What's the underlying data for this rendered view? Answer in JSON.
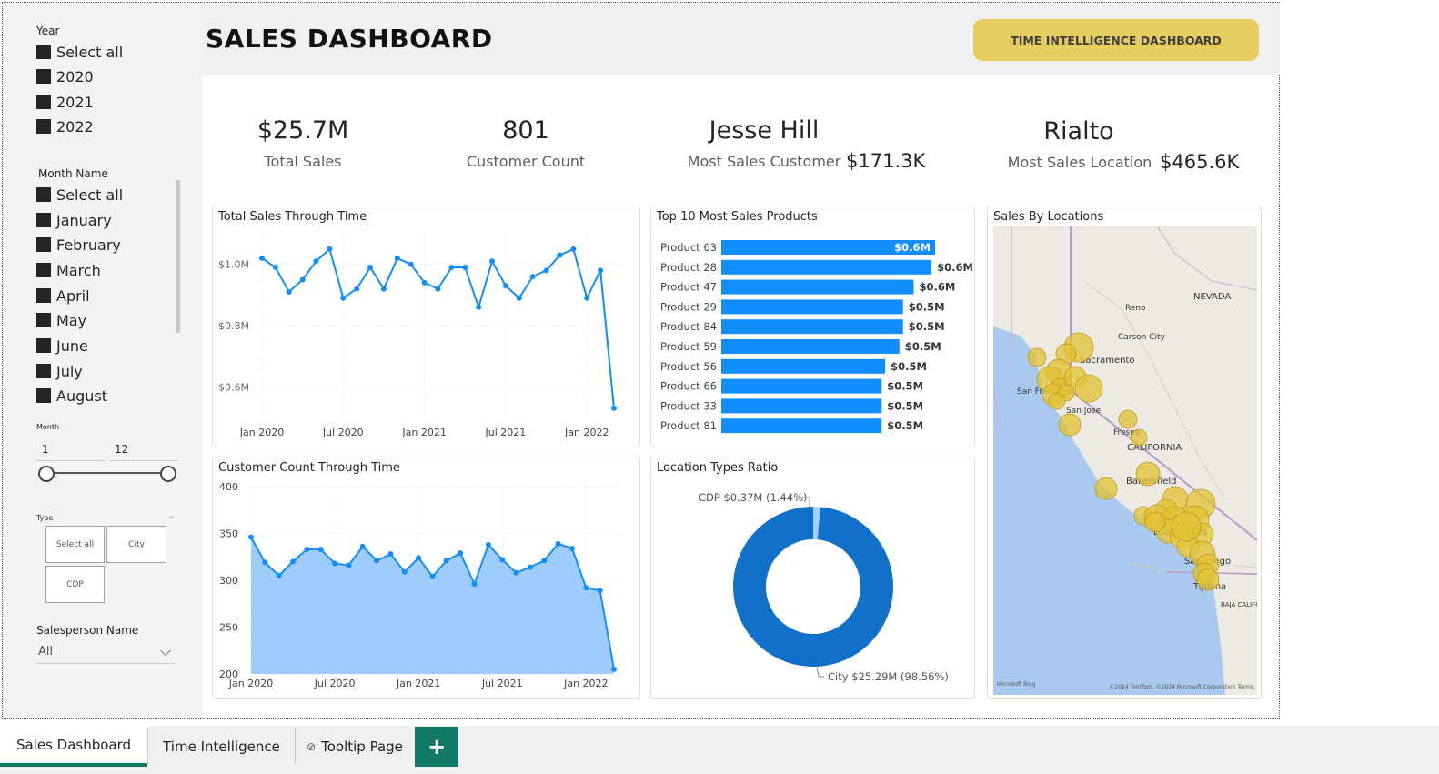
{
  "header": {
    "title": "SALES DASHBOARD",
    "ti_button": "TIME INTELLIGENCE DASHBOARD"
  },
  "slicers": {
    "year": {
      "title": "Year",
      "items": [
        "Select all",
        "2020",
        "2021",
        "2022"
      ]
    },
    "month_name": {
      "title": "Month Name",
      "items": [
        "Select all",
        "January",
        "February",
        "March",
        "April",
        "May",
        "June",
        "July",
        "August"
      ]
    },
    "month_range": {
      "title": "Month",
      "min": "1",
      "max": "12"
    },
    "type": {
      "title": "Type",
      "tiles": [
        "Select all",
        "City",
        "CDP"
      ]
    },
    "salesperson": {
      "title": "Salesperson Name",
      "value": "All"
    }
  },
  "kpis": {
    "total_sales": {
      "value": "$25.7M",
      "label": "Total Sales"
    },
    "customer_count": {
      "value": "801",
      "label": "Customer Count"
    },
    "top_customer": {
      "value": "Jesse Hill",
      "label": "Most Sales Customer",
      "amount": "$171.3K"
    },
    "top_location": {
      "value": "Rialto",
      "label": "Most Sales Location",
      "amount": "$465.6K"
    }
  },
  "visual_titles": {
    "sales_time": "Total Sales Through Time",
    "top_products": "Top 10 Most Sales Products",
    "locations": "Sales By Locations",
    "customer_time": "Customer Count Through Time",
    "location_types": "Location Types Ratio"
  },
  "map": {
    "labels": [
      "Reno",
      "NEVADA",
      "Carson City",
      "Sacramento",
      "San Francisco",
      "San Jose",
      "Fresno",
      "CALIFORNIA",
      "Bakersfield",
      "Los Angeles",
      "San Diego",
      "Tijuana",
      "BAJA CALIFORNIA"
    ],
    "attribution_left": "Microsoft Bing",
    "attribution_right": "©2024 TomTom, ©2024 Microsoft Corporation  Terms"
  },
  "tabs": [
    "Sales Dashboard",
    "Time Intelligence",
    "Tooltip Page"
  ],
  "tab_add_label": "+",
  "colors": {
    "accent": "#118dff",
    "area_fill": "#9fcdfb",
    "donut": "#1170c8",
    "donut_minor": "#a7cdf5",
    "bubble": "#e3c232",
    "button": "#e6cd62",
    "tab_active": "#117865"
  },
  "chart_data": [
    {
      "type": "line",
      "title": "Total Sales Through Time",
      "x_ticks": [
        "Jan 2020",
        "Jul 2020",
        "Jan 2021",
        "Jul 2021",
        "Jan 2022"
      ],
      "y_ticks": [
        "$1.0M",
        "$0.8M",
        "$0.6M"
      ],
      "ylim": [
        0.5,
        1.1
      ],
      "series": [
        {
          "values": [
            1.02,
            0.99,
            0.91,
            0.95,
            1.01,
            1.05,
            0.89,
            0.92,
            0.99,
            0.92,
            1.02,
            1.0,
            0.94,
            0.92,
            0.99,
            0.99,
            0.86,
            1.01,
            0.93,
            0.89,
            0.96,
            0.98,
            1.03,
            1.05,
            0.89,
            0.98,
            0.53
          ]
        }
      ]
    },
    {
      "type": "bar",
      "title": "Top 10 Most Sales Products",
      "categories": [
        "Product 63",
        "Product 28",
        "Product 47",
        "Product 29",
        "Product 84",
        "Product 59",
        "Product 56",
        "Product 66",
        "Product 33",
        "Product 81"
      ],
      "values": [
        0.6,
        0.59,
        0.54,
        0.51,
        0.51,
        0.5,
        0.46,
        0.45,
        0.45,
        0.45
      ],
      "labels": [
        "$0.6M",
        "$0.6M",
        "$0.6M",
        "$0.5M",
        "$0.5M",
        "$0.5M",
        "$0.5M",
        "$0.5M",
        "$0.5M",
        "$0.5M"
      ]
    },
    {
      "type": "area",
      "title": "Customer Count Through Time",
      "x_ticks": [
        "Jan 2020",
        "Jul 2020",
        "Jan 2021",
        "Jul 2021",
        "Jan 2022"
      ],
      "y_ticks": [
        "400",
        "350",
        "300",
        "250",
        "200"
      ],
      "ylim": [
        200,
        400
      ],
      "series": [
        {
          "values": [
            346,
            319,
            305,
            320,
            333,
            333,
            318,
            316,
            336,
            321,
            328,
            309,
            324,
            304,
            321,
            329,
            296,
            338,
            322,
            308,
            314,
            321,
            339,
            334,
            292,
            289,
            205
          ]
        }
      ]
    },
    {
      "type": "pie",
      "title": "Location Types Ratio",
      "slices": [
        {
          "name": "CDP",
          "value": 0.37,
          "percent": 1.44,
          "label": "CDP $0.37M (1.44%)"
        },
        {
          "name": "City",
          "value": 25.29,
          "percent": 98.56,
          "label": "City $25.29M (98.56%)"
        }
      ]
    }
  ]
}
